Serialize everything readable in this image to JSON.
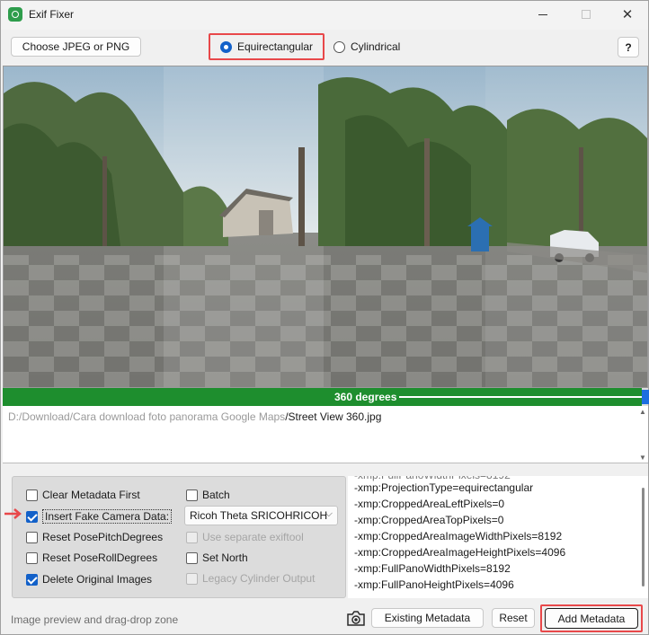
{
  "window": {
    "title": "Exif Fixer",
    "minimize": "—",
    "maximize": "☐",
    "close": "✕"
  },
  "toolbar": {
    "choose_label": "Choose JPEG or PNG",
    "projection": {
      "options": [
        "Equirectangular",
        "Cylindrical"
      ],
      "selected": "Equirectangular"
    },
    "help_label": "?"
  },
  "progress": {
    "label": "360 degrees",
    "fraction": 0.99,
    "color": "#1e8e2e"
  },
  "path": {
    "directory": "D:/Download/Cara download foto panorama Google Maps",
    "file": "/Street View 360.jpg"
  },
  "options": {
    "clear_metadata_first": {
      "label": "Clear Metadata First",
      "checked": false
    },
    "insert_fake_camera": {
      "label": "Insert Fake Camera Data:",
      "checked": true
    },
    "reset_pose_pitch": {
      "label": "Reset PosePitchDegrees",
      "checked": false
    },
    "reset_pose_roll": {
      "label": "Reset PoseRollDegrees",
      "checked": false
    },
    "delete_originals": {
      "label": "Delete Original Images",
      "checked": true
    },
    "batch": {
      "label": "Batch",
      "checked": false
    },
    "camera_model": "Ricoh Theta SRICOHRICOH",
    "use_separate_exiftool": {
      "label": "Use separate exiftool",
      "checked": false,
      "disabled": true
    },
    "set_north": {
      "label": "Set North",
      "checked": false
    },
    "legacy_cylinder": {
      "label": "Legacy Cylinder Output",
      "checked": false,
      "disabled": true
    }
  },
  "metadata_lines": [
    "-xmp:ProjectionType=equirectangular",
    "-xmp:CroppedAreaLeftPixels=0",
    "-xmp:CroppedAreaTopPixels=0",
    "-xmp:CroppedAreaImageWidthPixels=8192",
    "-xmp:CroppedAreaImageHeightPixels=4096",
    "-xmp:FullPanoWidthPixels=8192",
    "-xmp:FullPanoHeightPixels=4096"
  ],
  "bottom": {
    "hint": "Image preview and drag-drop zone",
    "existing_label": "Existing Metadata",
    "reset_label": "Reset",
    "add_label": "Add Metadata"
  },
  "icons": {
    "app": "app-icon",
    "camera": "camera-icon",
    "arrow": "red-arrow-icon"
  },
  "colors": {
    "accent": "#1361c9",
    "highlight": "#e8484a",
    "progress": "#1e8e2e"
  }
}
